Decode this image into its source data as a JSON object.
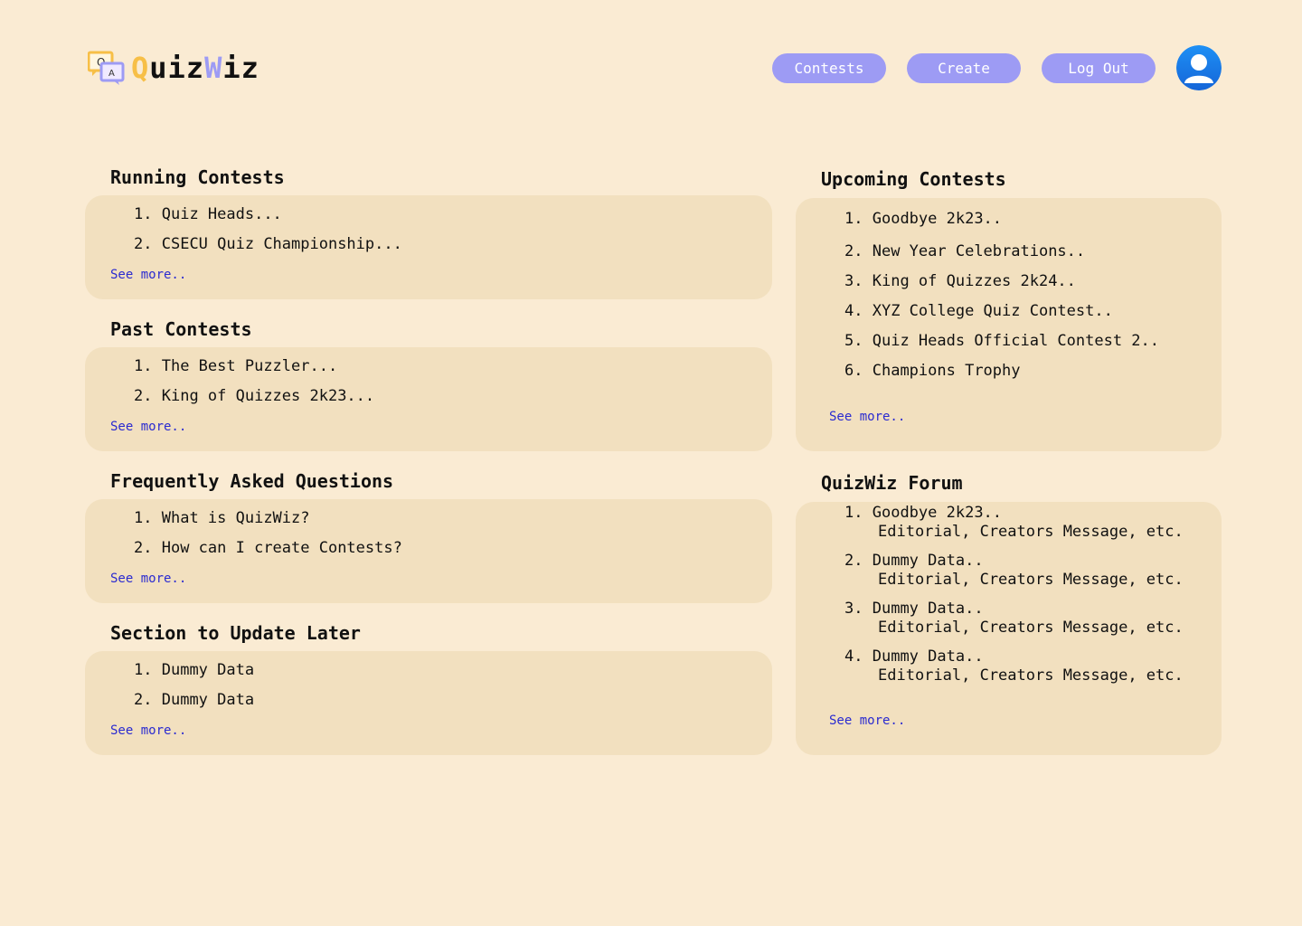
{
  "app": {
    "logo_q": "Q",
    "logo_a": "A",
    "name_part1": "Q",
    "name_part2": "uiz",
    "name_part3": "W",
    "name_part4": "iz"
  },
  "nav": {
    "contests": "Contests",
    "create": "Create",
    "logout": "Log Out"
  },
  "see_more": "See more..",
  "running": {
    "title": "Running Contests",
    "items": [
      "1.",
      "Quiz Heads...",
      "2.",
      "CSECU Quiz Championship..."
    ]
  },
  "past": {
    "title": "Past Contests",
    "items": [
      "1.",
      "The Best Puzzler...",
      "2.",
      "King of Quizzes 2k23..."
    ]
  },
  "faq": {
    "title": "Frequently Asked Questions",
    "items": [
      "1.",
      "What is QuizWiz?",
      "2.",
      "How can I create Contests?"
    ]
  },
  "later": {
    "title": "Section to Update Later",
    "items": [
      "1.",
      "Dummy Data",
      "2.",
      "Dummy Data"
    ]
  },
  "upcoming": {
    "title": "Upcoming Contests",
    "items": [
      "1.",
      "Goodbye 2k23..",
      "2.",
      "New Year Celebrations..",
      "3.",
      "King of Quizzes 2k24..",
      "4.",
      "XYZ College Quiz Contest..",
      "5.",
      "Quiz Heads Official Contest 2..",
      "6.",
      "Champions Trophy"
    ]
  },
  "forum": {
    "title": "QuizWiz Forum",
    "items": [
      {
        "num": "1.",
        "title": "Goodbye 2k23..",
        "sub": "Editorial, Creators Message, etc."
      },
      {
        "num": "2.",
        "title": "Dummy Data..",
        "sub": "Editorial, Creators Message, etc."
      },
      {
        "num": "3.",
        "title": "Dummy Data..",
        "sub": "Editorial, Creators Message, etc."
      },
      {
        "num": "4.",
        "title": "Dummy Data..",
        "sub": "Editorial, Creators Message, etc."
      }
    ]
  },
  "colors": {
    "background": "#faebd3",
    "card": "#f2e0bf",
    "accent_purple": "#9d9bf4",
    "accent_yellow": "#f7bf47",
    "link": "#2b2bd0",
    "avatar": "#1a8cf0"
  },
  "icons": {
    "logo": "qa-chat-bubbles-icon",
    "profile": "user-avatar-icon"
  }
}
